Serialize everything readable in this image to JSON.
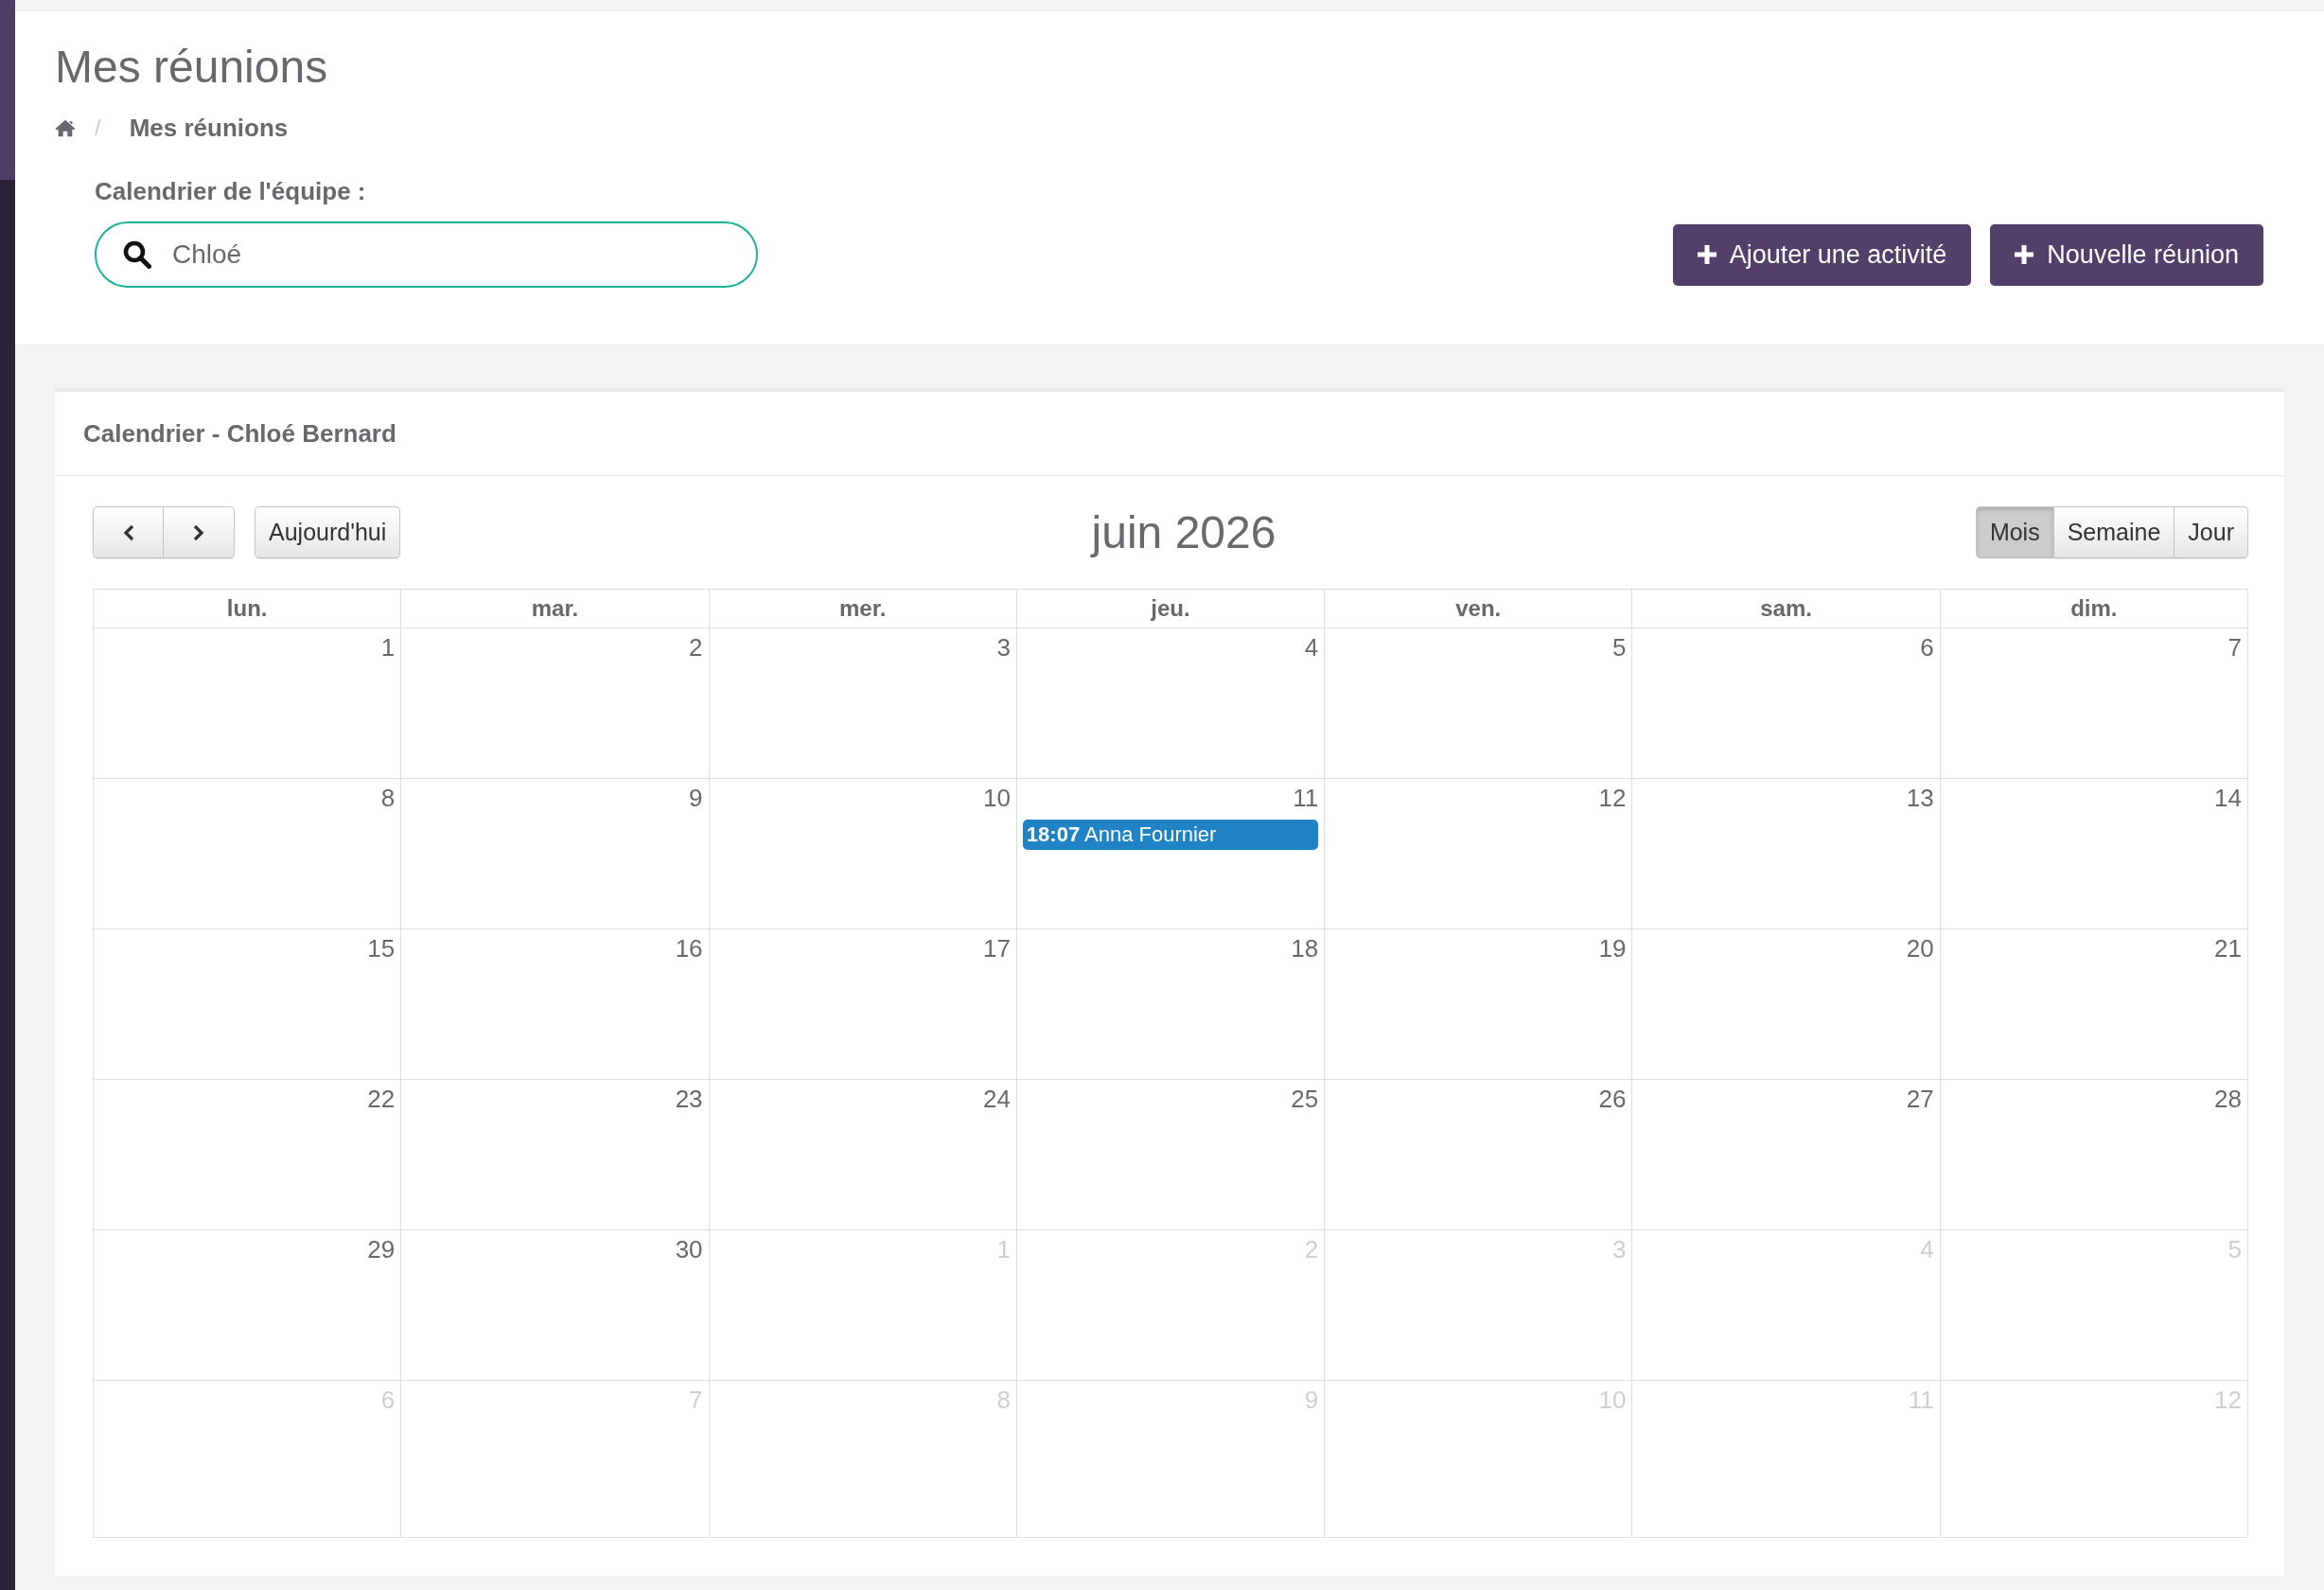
{
  "page": {
    "title": "Mes réunions"
  },
  "breadcrumb": {
    "separator": "/",
    "items": [
      {
        "kind": "home"
      },
      {
        "kind": "page",
        "label": "Mes réunions"
      }
    ]
  },
  "team_calendar": {
    "label": "Calendrier de l'équipe :",
    "search": {
      "value": "Chloé"
    }
  },
  "actions": [
    {
      "label": "Ajouter une activité"
    },
    {
      "label": "Nouvelle réunion"
    }
  ],
  "calendar": {
    "title": "Calendrier - Chloé Bernard",
    "today_button": "Aujourd'hui",
    "month": "juin 2026",
    "views": [
      {
        "label": "Mois",
        "selected": true
      },
      {
        "label": "Semaine",
        "selected": false
      },
      {
        "label": "Jour",
        "selected": false
      }
    ],
    "weekdays": [
      "lun.",
      "mar.",
      "mer.",
      "jeu.",
      "ven.",
      "sam.",
      "dim."
    ],
    "weeks": [
      {
        "days": [
          {
            "day": "1",
            "other_month": false
          },
          {
            "day": "2",
            "other_month": false
          },
          {
            "day": "3",
            "other_month": false
          },
          {
            "day": "4",
            "other_month": false
          },
          {
            "day": "5",
            "other_month": false
          },
          {
            "day": "6",
            "other_month": false
          },
          {
            "day": "7",
            "other_month": false
          }
        ]
      },
      {
        "days": [
          {
            "day": "8",
            "other_month": false
          },
          {
            "day": "9",
            "other_month": false
          },
          {
            "day": "10",
            "other_month": false
          },
          {
            "day": "11",
            "other_month": false,
            "events": [
              {
                "time": "18:07",
                "title": "Anna Fournier",
                "color": "#1f83c6"
              }
            ]
          },
          {
            "day": "12",
            "other_month": false
          },
          {
            "day": "13",
            "other_month": false
          },
          {
            "day": "14",
            "other_month": false
          }
        ]
      },
      {
        "days": [
          {
            "day": "15",
            "other_month": false
          },
          {
            "day": "16",
            "other_month": false
          },
          {
            "day": "17",
            "other_month": false
          },
          {
            "day": "18",
            "other_month": false
          },
          {
            "day": "19",
            "other_month": false
          },
          {
            "day": "20",
            "other_month": false
          },
          {
            "day": "21",
            "other_month": false
          }
        ]
      },
      {
        "days": [
          {
            "day": "22",
            "other_month": false
          },
          {
            "day": "23",
            "other_month": false
          },
          {
            "day": "24",
            "other_month": false
          },
          {
            "day": "25",
            "other_month": false
          },
          {
            "day": "26",
            "other_month": false
          },
          {
            "day": "27",
            "other_month": false
          },
          {
            "day": "28",
            "other_month": false
          }
        ]
      },
      {
        "days": [
          {
            "day": "29",
            "other_month": false
          },
          {
            "day": "30",
            "other_month": false
          },
          {
            "day": "1",
            "other_month": true
          },
          {
            "day": "2",
            "other_month": true
          },
          {
            "day": "3",
            "other_month": true
          },
          {
            "day": "4",
            "other_month": true
          },
          {
            "day": "5",
            "other_month": true
          }
        ]
      },
      {
        "days": [
          {
            "day": "6",
            "other_month": true
          },
          {
            "day": "7",
            "other_month": true
          },
          {
            "day": "8",
            "other_month": true
          },
          {
            "day": "9",
            "other_month": true
          },
          {
            "day": "10",
            "other_month": true
          },
          {
            "day": "11",
            "other_month": true
          },
          {
            "day": "12",
            "other_month": true
          }
        ]
      }
    ]
  }
}
